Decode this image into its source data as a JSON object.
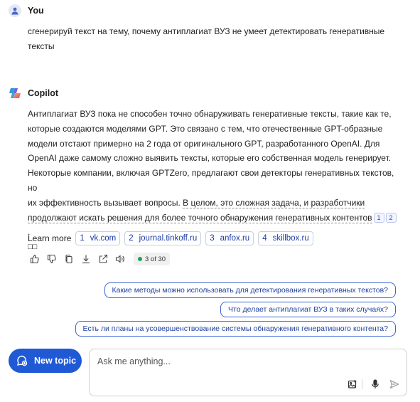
{
  "user": {
    "name": "You",
    "message_line1": "сгенерируй текст на тему, почему антиплагиат ВУЗ не умеет детектировать генеративные",
    "message_line2": "тексты"
  },
  "copilot": {
    "name": "Copilot",
    "lines": [
      "Антиплагиат ВУЗ пока не способен точно обнаруживать генеративные тексты, такие как те,",
      "которые создаются моделями GPT. Это связано с тем, что отечественные GPT-образные",
      "модели отстают примерно на 2 года от оригинального GPT, разработанного OpenAI. Для",
      "OpenAI даже самому сложно выявить тексты, которые его собственная модель генерирует.",
      "Некоторые компании, включая GPTZero, предлагают свои детекторы генеративных текстов, но",
      "их эффективность вызывает вопросы. "
    ],
    "highlight1": "В целом, это сложная задача, и разработчики",
    "highlight2": "продолжают искать решения для более точного обнаружения генеративных контентов",
    "cite1": "1",
    "cite2": "2",
    "end": ".",
    "tail": "□□"
  },
  "learn_more": {
    "label": "Learn more",
    "sources": [
      {
        "num": "1",
        "name": "vk.com"
      },
      {
        "num": "2",
        "name": "journal.tinkoff.ru"
      },
      {
        "num": "3",
        "name": "anfox.ru"
      },
      {
        "num": "4",
        "name": "skillbox.ru"
      }
    ]
  },
  "actions": {
    "icons": [
      "thumbs-up-icon",
      "thumbs-down-icon",
      "copy-icon",
      "download-icon",
      "share-icon",
      "speaker-icon"
    ],
    "count": "3 of 30",
    "count_color": "#1ba35a"
  },
  "suggestions": [
    "Какие методы можно использовать для детектирования генеративных текстов?",
    "Что делает антиплагиат ВУЗ в таких случаях?",
    "Есть ли планы на усовершенствование системы обнаружения генеративного контента?"
  ],
  "new_topic": {
    "label": "New topic",
    "color": "#2059d6"
  },
  "input": {
    "placeholder": "Ask me anything..."
  }
}
